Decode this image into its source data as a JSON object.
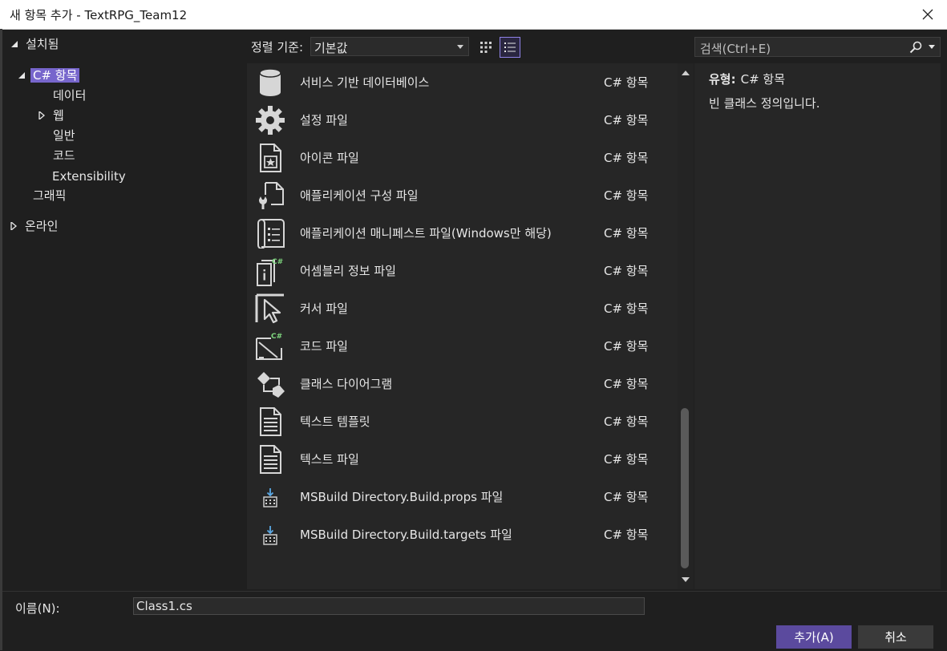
{
  "window": {
    "title": "새 항목 추가 - TextRPG_Team12"
  },
  "tree": [
    {
      "id": "installed",
      "label": "설치됨",
      "expanded": true
    },
    {
      "id": "csharp",
      "label": "C# 항목",
      "expanded": true,
      "selected": true
    },
    {
      "id": "data",
      "label": "데이터"
    },
    {
      "id": "web",
      "label": "웹",
      "expanded": false
    },
    {
      "id": "general",
      "label": "일반"
    },
    {
      "id": "code",
      "label": "코드"
    },
    {
      "id": "extensibility",
      "label": "Extensibility"
    },
    {
      "id": "graphics",
      "label": "그래픽"
    },
    {
      "id": "online",
      "label": "온라인",
      "expanded": false
    }
  ],
  "toolbar": {
    "sort_label": "정렬 기준:",
    "sort_value": "기본값"
  },
  "search": {
    "placeholder": "검색(Ctrl+E)"
  },
  "items": [
    {
      "name": "서비스 기반 데이터베이스",
      "category": "C# 항목",
      "icon": "database-icon"
    },
    {
      "name": "설정 파일",
      "category": "C# 항목",
      "icon": "gear-icon"
    },
    {
      "name": "아이콘 파일",
      "category": "C# 항목",
      "icon": "icon-file-icon"
    },
    {
      "name": "애플리케이션 구성 파일",
      "category": "C# 항목",
      "icon": "config-file-icon"
    },
    {
      "name": "애플리케이션 매니페스트 파일(Windows만 해당)",
      "category": "C# 항목",
      "icon": "manifest-file-icon"
    },
    {
      "name": "어셈블리 정보 파일",
      "category": "C# 항목",
      "icon": "assembly-info-icon"
    },
    {
      "name": "커서 파일",
      "category": "C# 항목",
      "icon": "cursor-file-icon"
    },
    {
      "name": "코드 파일",
      "category": "C# 항목",
      "icon": "code-file-icon"
    },
    {
      "name": "클래스 다이어그램",
      "category": "C# 항목",
      "icon": "class-diagram-icon"
    },
    {
      "name": "텍스트 템플릿",
      "category": "C# 항목",
      "icon": "text-template-icon"
    },
    {
      "name": "텍스트 파일",
      "category": "C# 항목",
      "icon": "text-file-icon"
    },
    {
      "name": "MSBuild Directory.Build.props 파일",
      "category": "C# 항목",
      "icon": "msbuild-icon"
    },
    {
      "name": "MSBuild Directory.Build.targets 파일",
      "category": "C# 항목",
      "icon": "msbuild-icon"
    }
  ],
  "details": {
    "type_label": "유형:",
    "type_value": "C# 항목",
    "description": "빈 클래스 정의입니다."
  },
  "bottom": {
    "name_label": "이름(N):",
    "name_value": "Class1.cs",
    "add_label": "추가(A)",
    "cancel_label": "취소"
  },
  "colors": {
    "accent": "#7766cc",
    "add_button": "#5b4a9e",
    "csharp_badge": "#7ed67e"
  }
}
